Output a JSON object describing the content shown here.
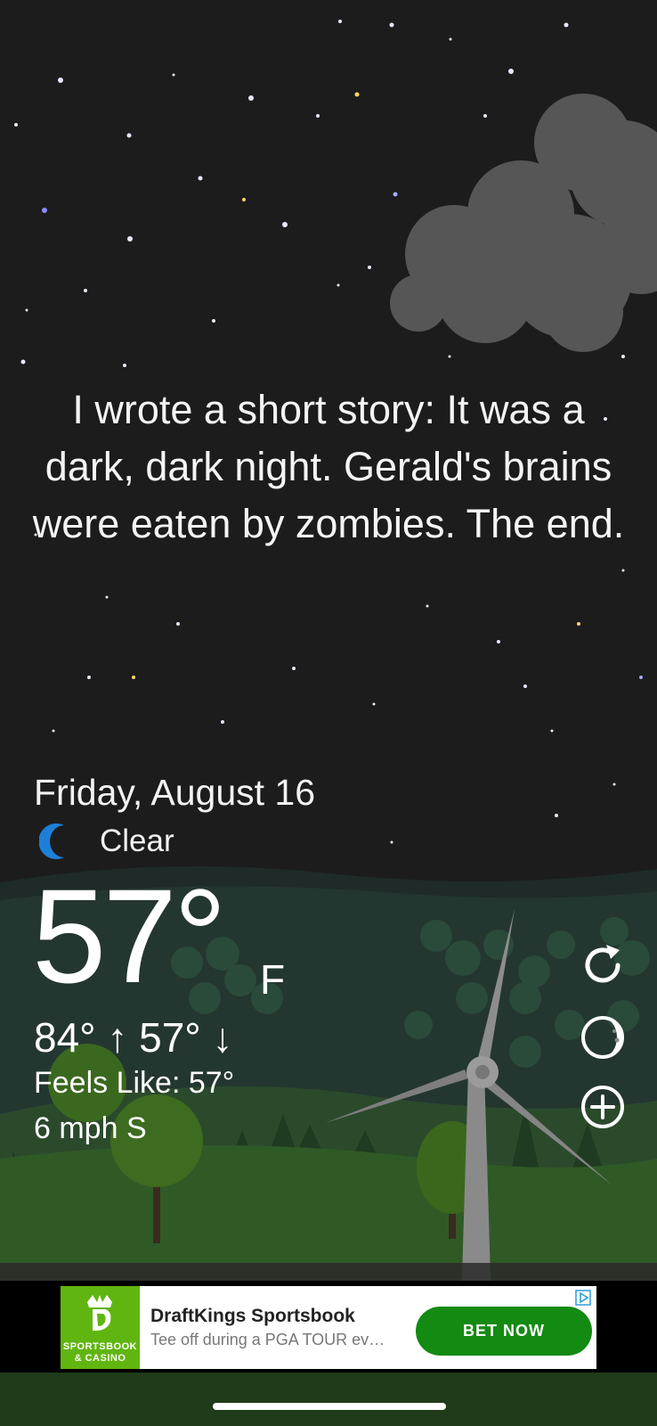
{
  "story": {
    "text": "I wrote a short story: It was a dark, dark night. Gerald's brains were eaten by zombies. The end."
  },
  "weather": {
    "date": "Friday, August 16",
    "condition": "Clear",
    "condition_icon": "moon-icon",
    "temperature": "57°",
    "unit": "F",
    "hi_lo": "84° ↑ 57° ↓",
    "feels_like": "Feels Like: 57°",
    "wind": "6 mph S"
  },
  "actions": {
    "refresh_icon": "refresh-icon",
    "moon_phase_icon": "moon-phase-icon",
    "add_icon": "add-location-icon"
  },
  "ad": {
    "brand_logo_text_top": "SPORTSBOOK",
    "brand_logo_text_bottom": "& CASINO",
    "title": "DraftKings Sportsbook",
    "description": "Tee off during a PGA TOUR ev…",
    "cta": "BET NOW",
    "brand_color": "#61b510",
    "cta_color": "#138a12"
  },
  "colors": {
    "sky": "#1c1c1c",
    "moon_accent": "#1e7fd8"
  }
}
